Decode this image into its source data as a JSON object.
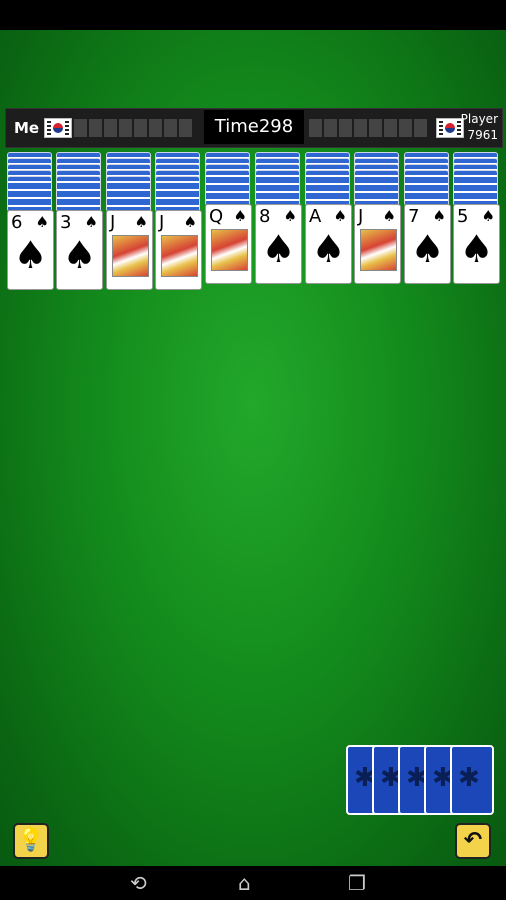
{
  "scoreboard": {
    "me_label": "Me",
    "timer_label": "Time",
    "timer_value": "298",
    "player_label": "Player",
    "player_score": "7961"
  },
  "tableau": [
    {
      "rank": "6",
      "suit": "♠",
      "face": false,
      "backs": 5
    },
    {
      "rank": "3",
      "suit": "♠",
      "face": false,
      "backs": 5
    },
    {
      "rank": "J",
      "suit": "♠",
      "face": true,
      "backs": 5
    },
    {
      "rank": "J",
      "suit": "♠",
      "face": true,
      "backs": 5
    },
    {
      "rank": "Q",
      "suit": "♠",
      "face": true,
      "backs": 4
    },
    {
      "rank": "8",
      "suit": "♠",
      "face": false,
      "backs": 4
    },
    {
      "rank": "A",
      "suit": "♠",
      "face": false,
      "backs": 4
    },
    {
      "rank": "J",
      "suit": "♠",
      "face": true,
      "backs": 4
    },
    {
      "rank": "7",
      "suit": "♠",
      "face": false,
      "backs": 4
    },
    {
      "rank": "5",
      "suit": "♠",
      "face": false,
      "backs": 4
    }
  ],
  "stock": {
    "count": 5,
    "icon": "spider-icon"
  },
  "controls": {
    "hint_icon": "lightbulb-icon",
    "undo_icon": "undo-icon"
  },
  "nav": {
    "back_icon": "back-icon",
    "home_icon": "home-icon",
    "recents_icon": "recents-icon"
  },
  "colors": {
    "felt": "#138a1c",
    "card_back": "#2f66d2",
    "button": "#f2d34a"
  }
}
